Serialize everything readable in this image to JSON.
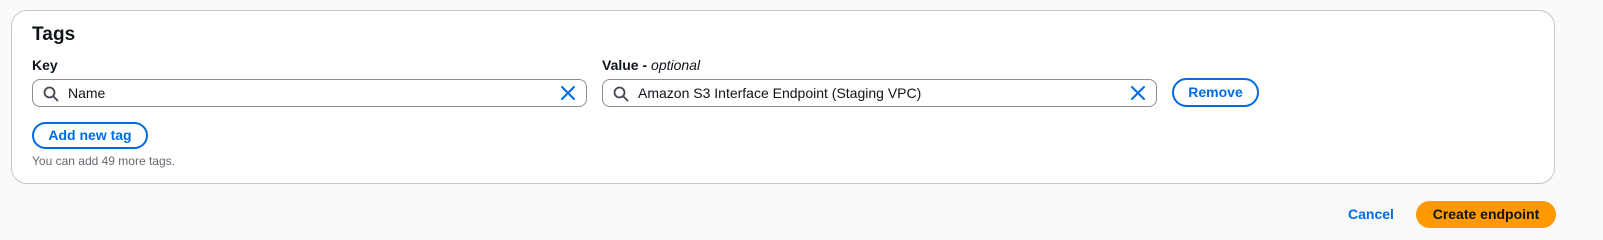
{
  "tags_section": {
    "title": "Tags",
    "key_label": "Key",
    "value_label": "Value -",
    "value_label_optional": "optional",
    "tag": {
      "key": "Name",
      "value": "Amazon S3 Interface Endpoint (Staging VPC)"
    },
    "remove_label": "Remove",
    "add_tag_label": "Add new tag",
    "helper_text": "You can add 49 more tags."
  },
  "footer": {
    "cancel_label": "Cancel",
    "create_label": "Create endpoint"
  },
  "icons": {
    "search": "search-icon",
    "clear": "close-icon"
  },
  "colors": {
    "accent": "#006ce0",
    "primary_button": "#ff9900",
    "panel_border": "#c6c6cd",
    "background": "#fafafa"
  }
}
